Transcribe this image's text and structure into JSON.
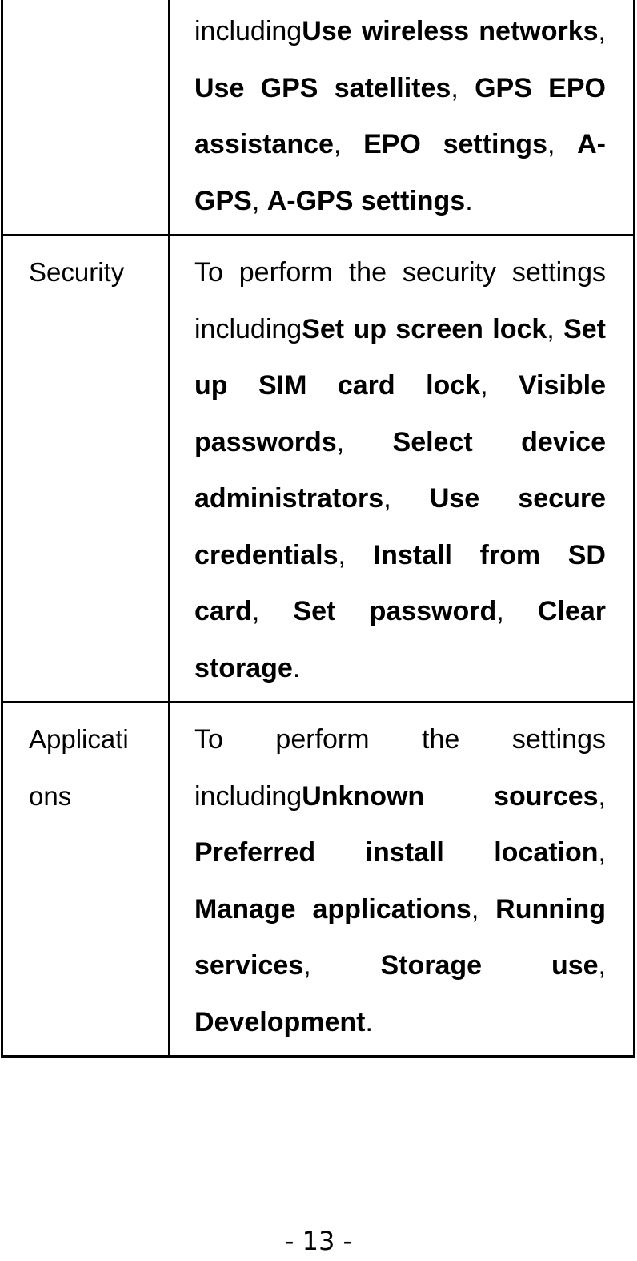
{
  "rows": [
    {
      "name": "",
      "segments": [
        {
          "t": "including",
          "b": false
        },
        {
          "t": "Use wireless networks",
          "b": true
        },
        {
          "t": ", ",
          "b": false
        },
        {
          "t": "Use GPS satellites",
          "b": true
        },
        {
          "t": ", ",
          "b": false
        },
        {
          "t": "GPS EPO assistance",
          "b": true
        },
        {
          "t": ", ",
          "b": false
        },
        {
          "t": "EPO settings",
          "b": true
        },
        {
          "t": ", ",
          "b": false
        },
        {
          "t": "A-GPS",
          "b": true
        },
        {
          "t": ", ",
          "b": false
        },
        {
          "t": "A-GPS settings",
          "b": true
        },
        {
          "t": ".",
          "b": false
        }
      ]
    },
    {
      "name": "Security",
      "segments": [
        {
          "t": "To perform the security settings including",
          "b": false
        },
        {
          "t": "Set up screen lock",
          "b": true
        },
        {
          "t": ", ",
          "b": false
        },
        {
          "t": "Set up SIM card lock",
          "b": true
        },
        {
          "t": ", ",
          "b": false
        },
        {
          "t": "Visible passwords",
          "b": true
        },
        {
          "t": ", ",
          "b": false
        },
        {
          "t": "Select device administrators",
          "b": true
        },
        {
          "t": ", ",
          "b": false
        },
        {
          "t": "Use secure credentials",
          "b": true
        },
        {
          "t": ", ",
          "b": false
        },
        {
          "t": "Install from SD card",
          "b": true
        },
        {
          "t": ", ",
          "b": false
        },
        {
          "t": "Set password",
          "b": true
        },
        {
          "t": ", ",
          "b": false
        },
        {
          "t": "Clear storage",
          "b": true
        },
        {
          "t": ".",
          "b": false
        }
      ]
    },
    {
      "name": "Applicati ons",
      "segments": [
        {
          "t": "To perform the settings including",
          "b": false
        },
        {
          "t": "Unknown sources",
          "b": true
        },
        {
          "t": ", ",
          "b": false
        },
        {
          "t": "Preferred install location",
          "b": true
        },
        {
          "t": ", ",
          "b": false
        },
        {
          "t": "Manage applications",
          "b": true
        },
        {
          "t": ", ",
          "b": false
        },
        {
          "t": "Running services",
          "b": true
        },
        {
          "t": ", ",
          "b": false
        },
        {
          "t": "Storage use",
          "b": true
        },
        {
          "t": ", ",
          "b": false
        },
        {
          "t": "Development",
          "b": true
        },
        {
          "t": ".",
          "b": false
        }
      ]
    }
  ],
  "page_number": "- 13 -"
}
